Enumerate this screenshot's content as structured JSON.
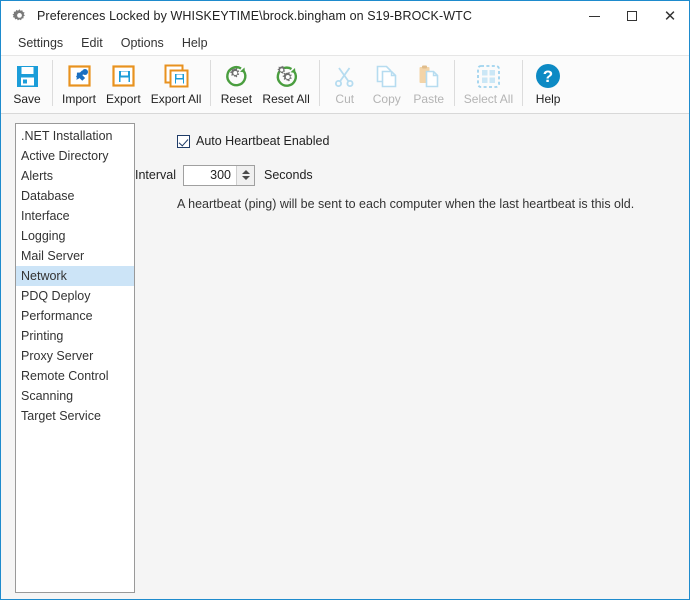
{
  "titlebar": {
    "icon": "gear-icon",
    "title": "Preferences Locked by WHISKEYTIME\\brock.bingham on S19-BROCK-WTC",
    "minimize": "–",
    "maximize": "□",
    "close": "✕"
  },
  "menubar": {
    "items": [
      {
        "label": "Settings"
      },
      {
        "label": "Edit"
      },
      {
        "label": "Options"
      },
      {
        "label": "Help"
      }
    ]
  },
  "toolbar": {
    "groups": [
      {
        "buttons": [
          {
            "label": "Save",
            "icon": "floppy-disk-icon",
            "disabled": false
          }
        ]
      },
      {
        "buttons": [
          {
            "label": "Import",
            "icon": "import-icon",
            "disabled": false
          },
          {
            "label": "Export",
            "icon": "export-icon",
            "disabled": false
          },
          {
            "label": "Export All",
            "icon": "export-all-icon",
            "disabled": false
          }
        ]
      },
      {
        "buttons": [
          {
            "label": "Reset",
            "icon": "reset-gear-icon",
            "disabled": false
          },
          {
            "label": "Reset All",
            "icon": "reset-all-gears-icon",
            "disabled": false
          }
        ]
      },
      {
        "buttons": [
          {
            "label": "Cut",
            "icon": "scissors-icon",
            "disabled": true
          },
          {
            "label": "Copy",
            "icon": "copy-pages-icon",
            "disabled": true
          },
          {
            "label": "Paste",
            "icon": "clipboard-paste-icon",
            "disabled": true
          }
        ]
      },
      {
        "buttons": [
          {
            "label": "Select All",
            "icon": "select-all-icon",
            "disabled": true
          }
        ]
      },
      {
        "buttons": [
          {
            "label": "Help",
            "icon": "help-circle-icon",
            "disabled": false
          }
        ]
      }
    ]
  },
  "sidebar": {
    "selected": "Network",
    "items": [
      {
        "label": ".NET Installation"
      },
      {
        "label": "Active Directory"
      },
      {
        "label": "Alerts"
      },
      {
        "label": "Database"
      },
      {
        "label": "Interface"
      },
      {
        "label": "Logging"
      },
      {
        "label": "Mail Server"
      },
      {
        "label": "Network"
      },
      {
        "label": "PDQ Deploy"
      },
      {
        "label": "Performance"
      },
      {
        "label": "Printing"
      },
      {
        "label": "Proxy Server"
      },
      {
        "label": "Remote Control"
      },
      {
        "label": "Scanning"
      },
      {
        "label": "Target Service"
      }
    ]
  },
  "pane": {
    "auto_heartbeat": {
      "label": "Auto Heartbeat Enabled",
      "checked": true
    },
    "interval": {
      "label": "Interval",
      "value": "300",
      "units": "Seconds"
    },
    "hint": "A heartbeat (ping) will be sent to each computer when the last heartbeat is this old."
  },
  "colors": {
    "window_border": "#1e8bcd",
    "selection": "#cce4f7",
    "accent_blue": "#0d8ac4",
    "accent_orange": "#e8921f",
    "accent_green": "#4a9e3f"
  }
}
